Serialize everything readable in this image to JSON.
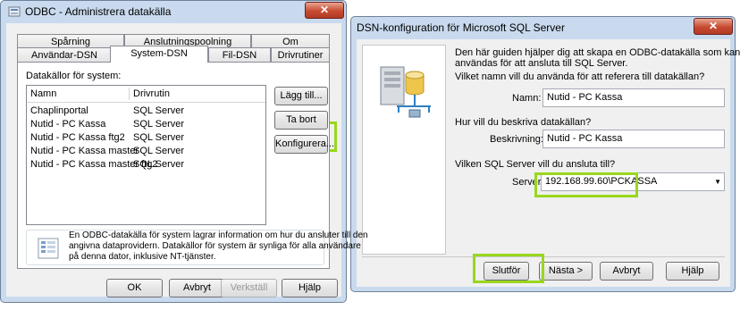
{
  "left": {
    "title": "ODBC - Administrera datakälla",
    "close": "✕",
    "tabs_top": [
      "Spårning",
      "Anslutningspoolning",
      "Om"
    ],
    "tabs_bottom": [
      "Användar-DSN",
      "System-DSN",
      "Fil-DSN",
      "Drivrutiner"
    ],
    "list_caption": "Datakällor för system:",
    "col_name": "Namn",
    "col_driver": "Drivrutin",
    "rows": [
      {
        "name": "Chaplinportal",
        "driver": "SQL Server"
      },
      {
        "name": "Nutid - PC Kassa",
        "driver": "SQL Server"
      },
      {
        "name": "Nutid - PC Kassa ftg2",
        "driver": "SQL Server"
      },
      {
        "name": "Nutid - PC Kassa master",
        "driver": "SQL Server"
      },
      {
        "name": "Nutid - PC Kassa master ftg2",
        "driver": "SQL Server"
      }
    ],
    "btn_add": "Lägg till...",
    "btn_remove": "Ta bort",
    "btn_configure": "Konfigurera...",
    "info_line1": "En ODBC-datakälla för system lagrar information om hur du ansluter till den",
    "info_line2": "angivna dataprovidern. Datakällor för system är synliga för alla användare",
    "info_line3": "på denna dator, inklusive NT-tjänster.",
    "btn_ok": "OK",
    "btn_cancel": "Avbryt",
    "btn_apply": "Verkställ",
    "btn_help": "Hjälp"
  },
  "right": {
    "title": "DSN-konfiguration för Microsoft SQL Server",
    "close": "✕",
    "intro1": "Den här guiden hjälper dig att skapa en ODBC-datakälla som kan",
    "intro2": "användas för att ansluta till SQL Server.",
    "q_name": "Vilket namn vill du använda för att referera till datakällan?",
    "name_label": "Namn:",
    "name_value": "Nutid - PC Kassa",
    "q_desc": "Hur vill du beskriva datakällan?",
    "desc_label": "Beskrivning:",
    "desc_value": "Nutid - PC Kassa",
    "q_server": "Vilken SQL Server vill du ansluta till?",
    "server_label": "Server:",
    "server_value": "192.168.99.60\\PCKASSA",
    "btn_finish": "Slutför",
    "btn_next": "Nästa >",
    "btn_cancel": "Avbryt",
    "btn_help": "Hjälp"
  },
  "colors": {
    "highlight": "#99d71e",
    "frame": "#c9daee",
    "close": "#c74a31"
  }
}
